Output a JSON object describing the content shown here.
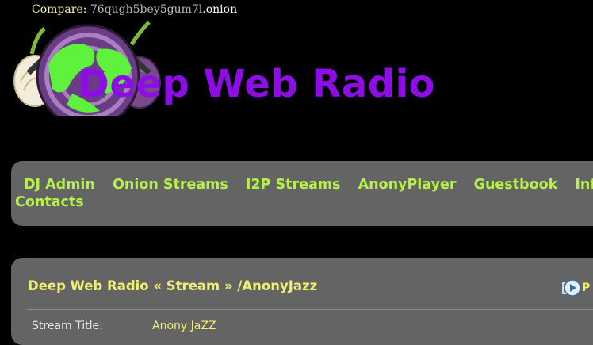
{
  "header": {
    "compare_label": "Compare:",
    "compare_gray": "76qugh5bey5gum7l",
    "compare_white": ".onion",
    "site_title": "Deep Web Radio"
  },
  "nav": {
    "items": [
      "DJ Admin",
      "Onion Streams",
      "I2P Streams",
      "AnonyPlayer",
      "Guestbook",
      "Inf"
    ],
    "second_row": "Contacts"
  },
  "panel": {
    "title": "Deep Web Radio « Stream » /AnonyJazz",
    "play_label": "P",
    "stream_title_label": "Stream Title:",
    "stream_title_value": "Anony JaZZ"
  },
  "colors": {
    "background": "#000000",
    "title_purple": "#8e0de6",
    "nav_green": "#b6f04a",
    "panel_gray": "#646464",
    "panel_yellow": "#f1ef6e"
  }
}
